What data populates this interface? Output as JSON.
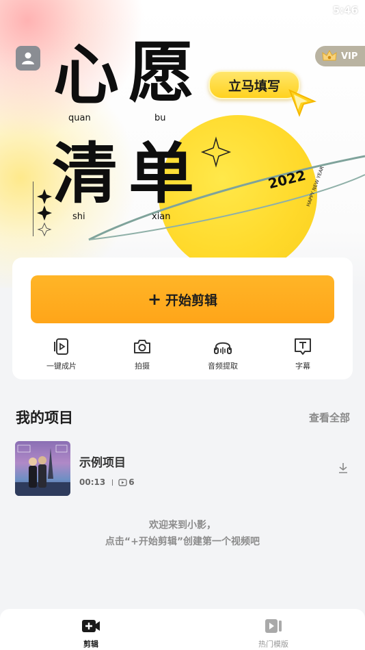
{
  "status": {
    "time": "5:46"
  },
  "header": {
    "vip_label": "VIP"
  },
  "banner": {
    "chars": [
      "心",
      "愿",
      "清",
      "单"
    ],
    "pinyin": [
      "quan",
      "bu",
      "shi",
      "xian"
    ],
    "sticker": "立马填写",
    "year": "2022",
    "happy": "HAPPY NEW YEAR"
  },
  "actions": {
    "start_plus": "+",
    "start_label": "开始剪辑",
    "tools": [
      {
        "label": "一键成片",
        "icon": "one-click-video-icon"
      },
      {
        "label": "拍摄",
        "icon": "camera-icon"
      },
      {
        "label": "音频提取",
        "icon": "headphones-icon"
      },
      {
        "label": "字幕",
        "icon": "subtitle-icon"
      }
    ]
  },
  "projects": {
    "title": "我的项目",
    "view_all": "查看全部",
    "items": [
      {
        "name": "示例项目",
        "duration": "00:13",
        "clips": "6"
      }
    ]
  },
  "welcome": {
    "line1": "欢迎来到小影，",
    "line2": "点击“+开始剪辑”创建第一个视频吧"
  },
  "tabs": [
    {
      "label": "剪辑",
      "active": true
    },
    {
      "label": "热门模版",
      "active": false
    }
  ],
  "colors": {
    "accent": "#ffab1f",
    "sun": "#ffd92a"
  }
}
